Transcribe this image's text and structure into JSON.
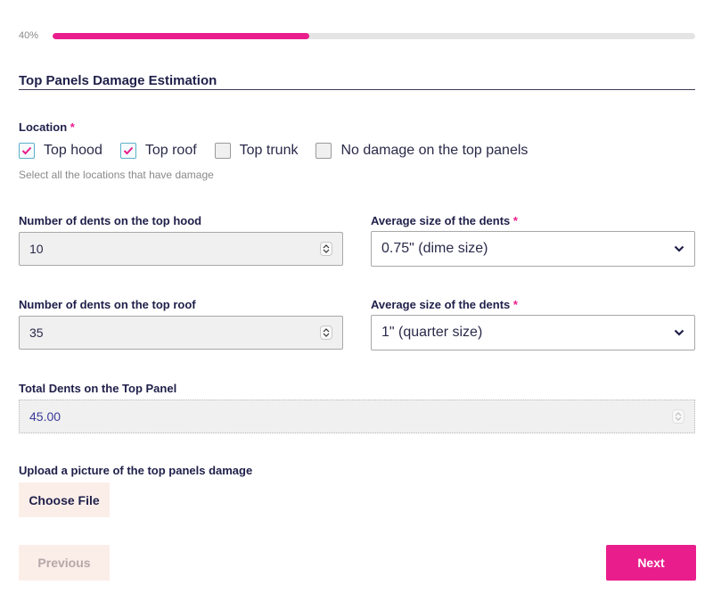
{
  "progress": {
    "label": "40%",
    "value_percent": 40,
    "fill_color": "#e91e8c",
    "track_color": "#e4e4e4"
  },
  "section": {
    "title": "Top Panels Damage Estimation"
  },
  "location": {
    "label": "Location",
    "required_mark": "*",
    "options": [
      {
        "label": "Top hood",
        "checked": true
      },
      {
        "label": "Top roof",
        "checked": true
      },
      {
        "label": "Top trunk",
        "checked": false
      },
      {
        "label": "No damage on the top panels",
        "checked": false
      }
    ],
    "hint": "Select all the locations that have damage"
  },
  "hood": {
    "count_label": "Number of dents on the top hood",
    "count_value": "10",
    "size_label": "Average size of the dents",
    "size_required_mark": "*",
    "size_value": "0.75\" (dime size)"
  },
  "roof": {
    "count_label": "Number of dents on the top roof",
    "count_value": "35",
    "size_label": "Average size of the dents",
    "size_required_mark": "*",
    "size_value": "1\" (quarter size)"
  },
  "total": {
    "label": "Total Dents on the Top Panel",
    "value": "45.00"
  },
  "upload": {
    "label": "Upload a picture of the top panels damage",
    "button_label": "Choose File"
  },
  "nav": {
    "previous_label": "Previous",
    "next_label": "Next"
  },
  "colors": {
    "accent": "#e91e8c",
    "text": "#1f1f4a",
    "button_light": "#fbeee9"
  },
  "icons": {
    "checkbox_check": "checkmark-icon",
    "spinner": "spinner-arrows-icon",
    "dropdown": "chevron-down-icon"
  }
}
